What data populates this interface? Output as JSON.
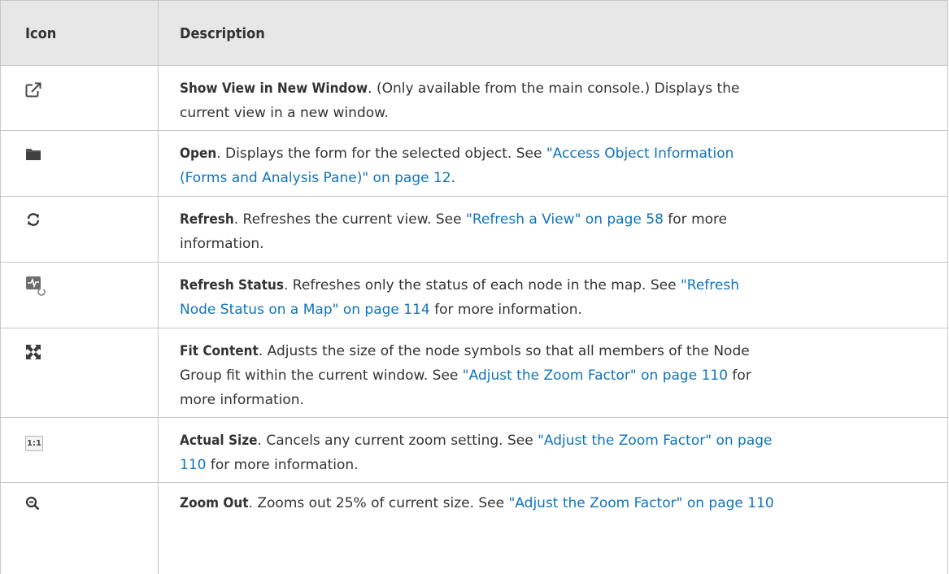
{
  "header": {
    "col_icon": "Icon",
    "col_description": "Description"
  },
  "rows": [
    {
      "icon": "external-window-icon",
      "title": "Show View in New Window",
      "text1": ". (Only available from the main console.) Displays the",
      "text2": "current view in a new window."
    },
    {
      "icon": "folder-icon",
      "title": "Open",
      "text1": ". Displays the form for the selected object. See ",
      "link1": "\"Access Object Information",
      "link2": "(Forms and Analysis Pane)\" on page 12",
      "text2": "."
    },
    {
      "icon": "refresh-icon",
      "title": "Refresh",
      "text1": ". Refreshes the current view. See ",
      "link1": "\"Refresh a View\" on page 58",
      "text2": " for more",
      "text3": "information."
    },
    {
      "icon": "refresh-status-icon",
      "title": "Refresh Status",
      "text1": ". Refreshes only the status of each node in the map. See ",
      "link1": "\"Refresh",
      "link2": "Node Status on a Map\" on page 114",
      "text2": " for more information."
    },
    {
      "icon": "fit-content-icon",
      "title": "Fit Content",
      "text1": ". Adjusts the size of the node symbols so that all members of the Node",
      "text2": "Group fit within the current window. See ",
      "link1": "\"Adjust the Zoom Factor\" on page 110",
      "text3": " for",
      "text4": "more information."
    },
    {
      "icon": "actual-size-icon",
      "icon_text": "1:1",
      "title": "Actual Size",
      "text1": ". Cancels any current zoom setting. See ",
      "link1": "\"Adjust the Zoom Factor\" on page",
      "link2": "110",
      "text2": " for more information."
    },
    {
      "icon": "zoom-out-icon",
      "title": "Zoom Out",
      "text1": ". Zooms out 25% of current size. See ",
      "link1": "\"Adjust the Zoom Factor\" on page 110"
    }
  ]
}
